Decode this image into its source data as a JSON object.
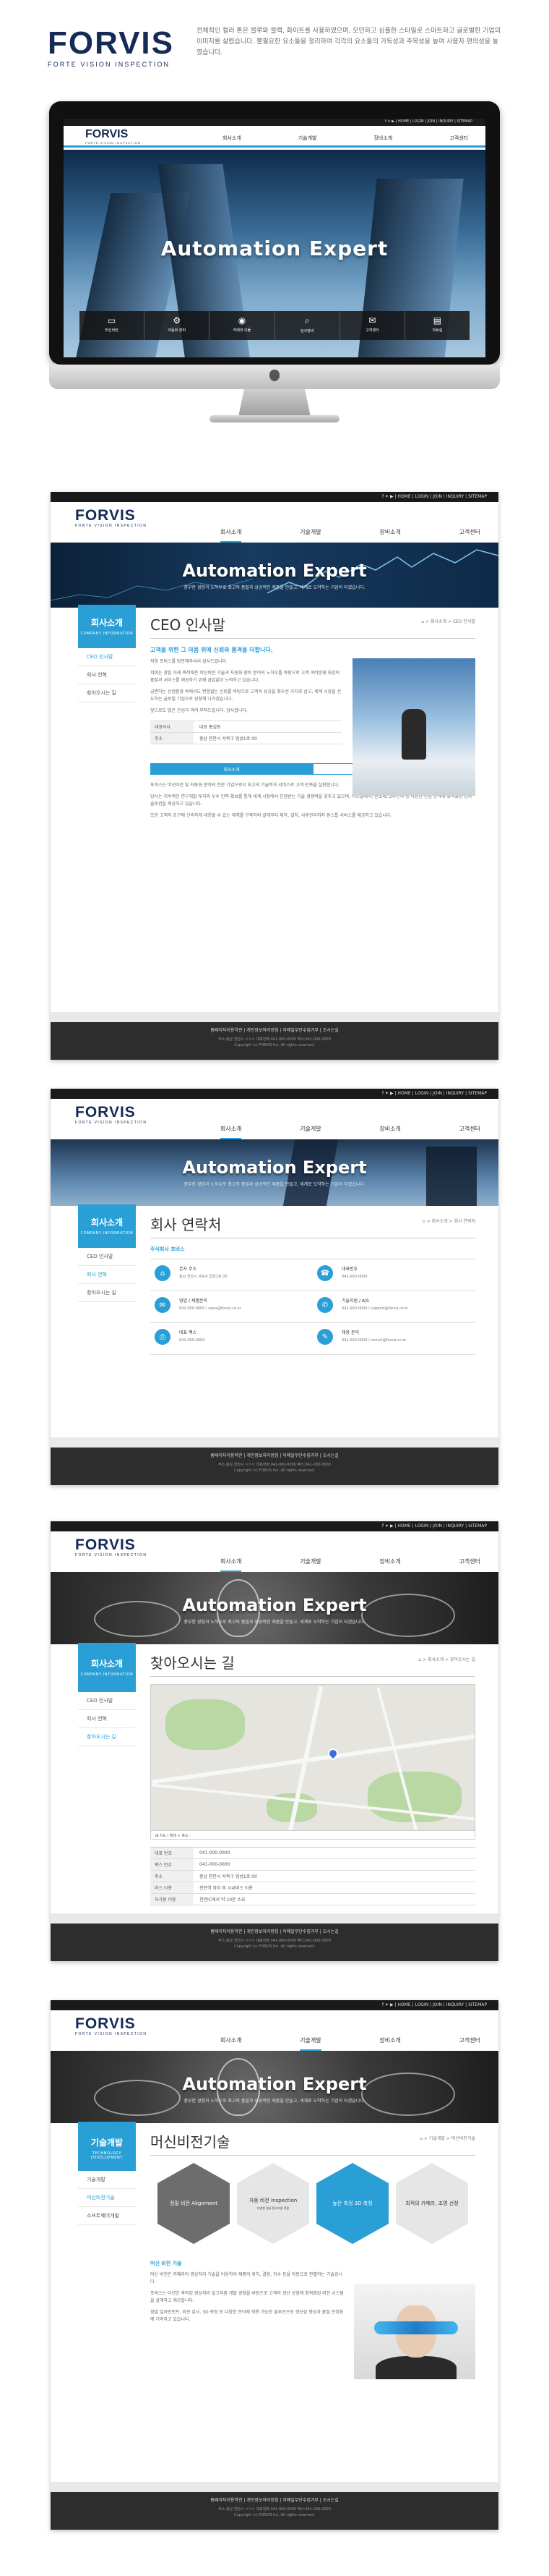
{
  "intro": {
    "logo": "FORVIS",
    "logo_sub": "FORTE VISION INSPECTION",
    "description": "전체적인 컬러 톤은 블루와 블랙, 화이트를 사용하였으며, 모던하고 심플한 스타일로 스마트하고 글로벌한 기업의 이미지를 살렸습니다. 불필요한 요소들을 정리하여 각각의 요소들의 가독성과 주목성을 높여 사용자 편의성을 높였습니다."
  },
  "site": {
    "logo": "FORVIS",
    "logo_sub": "FORTE VISION INSPECTION",
    "top_links": "f  ✦  ▶  |  HOME  |  LOGIN  |  JOIN  |  INQUIRY  |  SITEMAP",
    "nav": [
      "회사소개",
      "기술개발",
      "장비소개",
      "고객센터"
    ],
    "hero_title": "Automation Expert",
    "hero_sub": "풍부한 경험과 노하우로 최고의 품질과 성공적인 제품을 만들고, 세계로 도약하는 기업이 되겠습니다.",
    "footer_links": "홈페이지이용약관  |  개인정보처리방침  |  이메일무단수집거부  |  오시는길",
    "footer_address": "주소:충남 천안시 ㅇㅇㅇ  대표전화:041-000-0000  팩스:041-000-0000",
    "footer_copy": "Copyright (c) FORVIS Inc. All rights reserved."
  },
  "imac_icons": [
    "머신비전",
    "자동화 장비",
    "카메라 모듈",
    "검사장비",
    "고객센터",
    "자료실"
  ],
  "ceo_page": {
    "side_title": "회사소개",
    "side_sub": "COMPANY INFORMATION",
    "side_menu": [
      "CEO 인사말",
      "회사 연혁",
      "찾아오시는 길"
    ],
    "title": "CEO 인사말",
    "crumb": "⌂  >  회사소개  >  CEO 인사말",
    "lead": "고객을 위한 그 마음 위에 신뢰와 품격을 더합니다.",
    "paragraphs": [
      "저희 포비스를 방문해주셔서 감사드립니다.",
      "저희는 창립 이래 축적해온 머신비전 기술과 자동화 장비 분야의 노하우를 바탕으로 고객 여러분께 최상의 품질과 서비스를 제공하기 위해 끊임없이 노력하고 있습니다.",
      "급변하는 산업환경 속에서도 변함없는 신뢰를 바탕으로 고객의 성공을 최우선 가치로 삼고, 세계 시장을 선도하는 글로벌 기업으로 성장해 나가겠습니다.",
      "앞으로도 많은 관심과 격려 부탁드립니다. 감사합니다."
    ],
    "sign_rows": [
      [
        "대표이사",
        "대표 홍길동"
      ],
      [
        "주소",
        "충남 천안시 서북구 업성1로 00"
      ]
    ],
    "tabs": [
      "회사소개",
      "사업영역"
    ],
    "bottom_paragraphs": [
      "포비스는 머신비전 및 자동화 분야의 전문 기업으로서 최고의 기술력과 서비스로 고객 만족을 실현합니다.",
      "당사는 지속적인 연구개발 투자와 우수 인력 확보를 통해 세계 시장에서 인정받는 기술 경쟁력을 갖추고 있으며, 디스플레이, 반도체, 2차전지 등 다양한 산업 분야에 최적화된 검사 솔루션을 제공하고 있습니다.",
      "또한 고객의 요구에 신속하게 대응할 수 있는 체계를 구축하여 설계부터 제작, 설치, 사후관리까지 원스톱 서비스를 제공하고 있습니다."
    ]
  },
  "contact_page": {
    "title": "회사 연락처",
    "crumb": "⌂  >  회사소개  >  회사 연락처",
    "sub": "주식회사 포비스",
    "items": [
      {
        "icon": "⌂",
        "h": "본사 주소",
        "v": "충남 천안시 서북구 업성1로 00"
      },
      {
        "icon": "☎",
        "h": "대표번호",
        "v": "041-000-0000"
      },
      {
        "icon": "✉",
        "h": "영업 / 제품문의",
        "v": "041-000-0000 / sales@forvis.co.kr"
      },
      {
        "icon": "✆",
        "h": "기술지원 / A/S",
        "v": "041-000-0000 / support@forvis.co.kr"
      },
      {
        "icon": "⎙",
        "h": "대표 팩스",
        "v": "041-000-0000"
      },
      {
        "icon": "✎",
        "h": "채용 문의",
        "v": "041-000-0000 / recruit@forvis.co.kr"
      }
    ]
  },
  "map_page": {
    "title": "찾아오시는 길",
    "crumb": "⌂  >  회사소개  >  찾아오시는 길",
    "map_footer": "⊞ 지도  |  확대 +  축소 -",
    "rows": [
      [
        "대표 번호",
        "041-000-0000"
      ],
      [
        "팩스 번호",
        "041-000-0000"
      ],
      [
        "주소",
        "충남 천안시 서북구 업성1로 00"
      ],
      [
        "버스 이용",
        "천안역 하차 후 시내버스 이용"
      ],
      [
        "자가용 이용",
        "천안IC에서 약 10분 소요"
      ]
    ]
  },
  "vision_page": {
    "side_title": "기술개발",
    "side_sub": "TECHNOLOGY DEVELOPMENT",
    "side_menu": [
      "기술개발",
      "머신비전기술",
      "소프트웨어개발"
    ],
    "title": "머신비전기술",
    "crumb": "⌂  >  기술개발  >  머신비전기술",
    "hexes": [
      {
        "title": "정밀 비전 Alignment",
        "sm": "",
        "bg": "#6d6d6d",
        "fg": "#ffffff"
      },
      {
        "title": "자동 비전 Inspection",
        "sm": "다양한 검사 알고리즘 적용",
        "bg": "#e6e6e6",
        "fg": "#333333"
      },
      {
        "title": "높은 측정 3D 측정",
        "sm": "",
        "bg": "#2a9fd6",
        "fg": "#ffffff"
      },
      {
        "title": "최적의 카메라, 조명 선정",
        "sm": "",
        "bg": "#e6e6e6",
        "fg": "#333333"
      }
    ],
    "sub": "머신 비전 기술",
    "paragraphs": [
      "머신 비전은 카메라와 영상처리 기술을 이용하여 제품의 위치, 결함, 치수 등을 자동으로 판별하는 기술입니다.",
      "포비스는 다년간 축적된 영상처리 알고리즘 개발 경험을 바탕으로 고객의 생산 공정에 최적화된 비전 시스템을 설계하고 제공합니다.",
      "정밀 얼라인먼트, 외관 검사, 3D 측정 등 다양한 분야에 적용 가능한 솔루션으로 생산성 향상과 품질 안정화에 기여하고 있습니다."
    ]
  },
  "colors": {
    "accent": "#2a9fd6",
    "brand": "#152a55",
    "footer": "#2d2d2d"
  }
}
